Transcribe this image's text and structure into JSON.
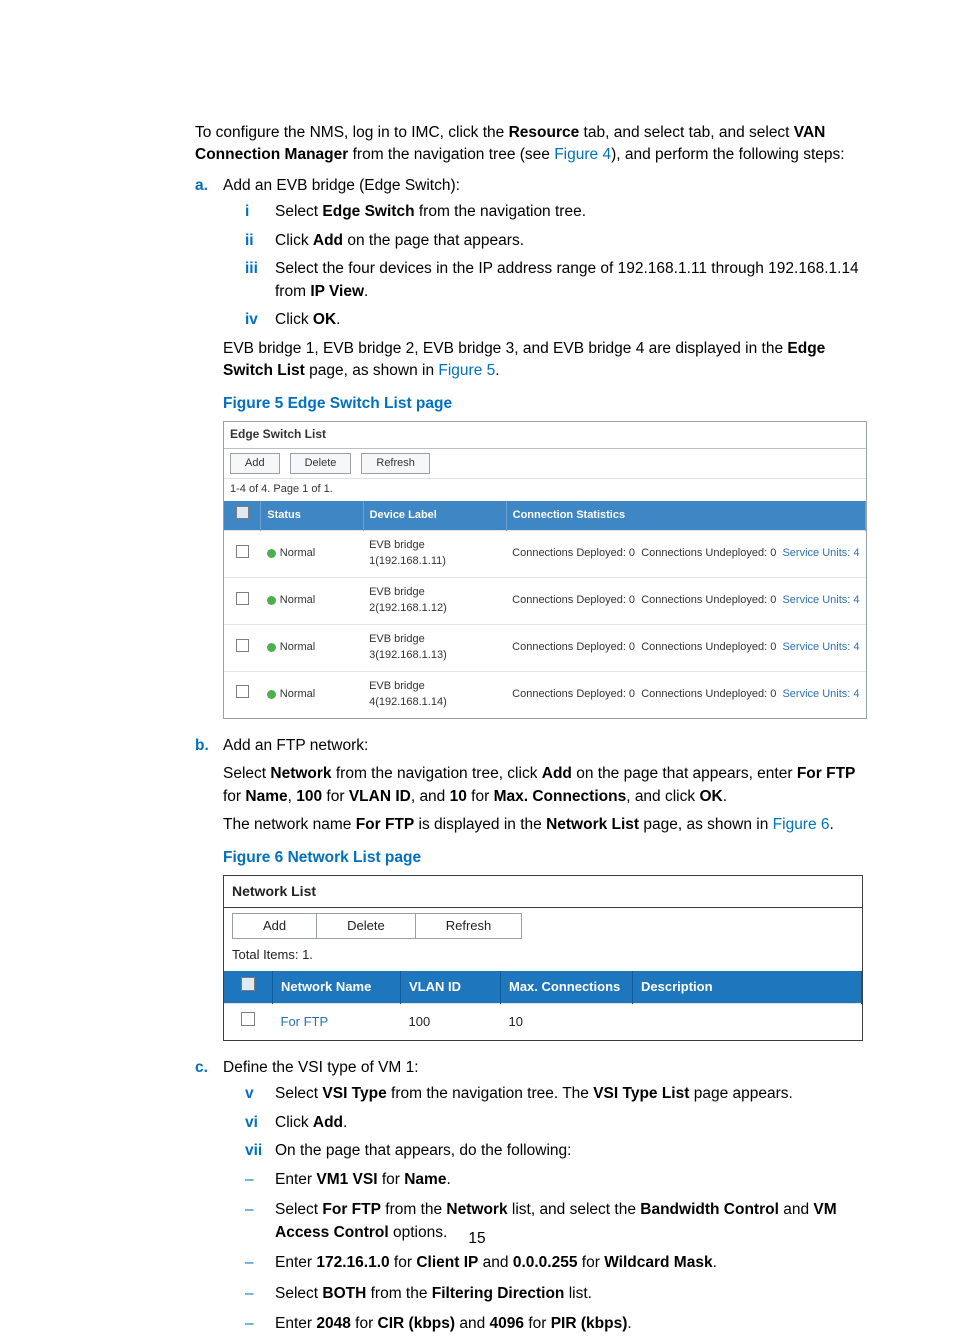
{
  "intro": {
    "p1_pre": "To configure the NMS, log in to IMC, click the ",
    "resource": "Resource",
    "p1_mid": " tab, and select ",
    "vcm": "VAN Connection Manager",
    "p1_post1": " from the navigation tree (see ",
    "fig4": "Figure 4",
    "p1_post2": "), and perform the following steps:"
  },
  "a": {
    "marker": "a.",
    "title": "Add an EVB bridge (Edge Switch):",
    "i": {
      "m": "i",
      "pre": "Select ",
      "b": "Edge Switch",
      "post": " from the navigation tree."
    },
    "ii": {
      "m": "ii",
      "pre": "Click ",
      "b": "Add",
      "post": " on the page that appears."
    },
    "iii": {
      "m": "iii",
      "pre": "Select the four devices in the IP address range of 192.168.1.11 through 192.168.1.14 from ",
      "b": "IP View",
      "post": "."
    },
    "iv": {
      "m": "iv",
      "pre": "Click ",
      "b": "OK",
      "post": "."
    },
    "result_pre": "EVB bridge 1, EVB bridge 2, EVB bridge 3, and EVB bridge 4 are displayed in the ",
    "result_b": "Edge Switch List",
    "result_mid": " page, as shown in ",
    "result_link": "Figure 5",
    "result_post": "."
  },
  "fig5": {
    "caption": "Figure 5 Edge Switch List page",
    "title": "Edge Switch List",
    "buttons": {
      "add": "Add",
      "delete": "Delete",
      "refresh": "Refresh"
    },
    "pager": "1-4 of 4. Page 1 of 1.",
    "headers": {
      "status": "Status",
      "device": "Device Label",
      "conn": "Connection Statistics"
    },
    "rows": [
      {
        "status": "Normal",
        "device": "EVB bridge 1(192.168.1.11)",
        "cd": "Connections Deployed: 0",
        "cu": "Connections Undeployed: 0",
        "su": "Service Units: 4"
      },
      {
        "status": "Normal",
        "device": "EVB bridge 2(192.168.1.12)",
        "cd": "Connections Deployed: 0",
        "cu": "Connections Undeployed: 0",
        "su": "Service Units: 4"
      },
      {
        "status": "Normal",
        "device": "EVB bridge 3(192.168.1.13)",
        "cd": "Connections Deployed: 0",
        "cu": "Connections Undeployed: 0",
        "su": "Service Units: 4"
      },
      {
        "status": "Normal",
        "device": "EVB bridge 4(192.168.1.14)",
        "cd": "Connections Deployed: 0",
        "cu": "Connections Undeployed: 0",
        "su": "Service Units: 4"
      }
    ]
  },
  "b": {
    "marker": "b.",
    "title": "Add an FTP network:",
    "p1": {
      "t1": "Select ",
      "b1": "Network",
      "t2": " from the navigation tree, click ",
      "b2": "Add",
      "t3": " on the page that appears, enter ",
      "b3": "For FTP",
      "t4": " for ",
      "b4": "Name",
      "t5": ", ",
      "b5": "100",
      "t6": " for ",
      "b6": "VLAN ID",
      "t7": ", and ",
      "b7": "10",
      "t8": " for ",
      "b8": "Max. Connections",
      "t9": ", and click ",
      "b9": "OK",
      "t10": "."
    },
    "p2": {
      "t1": "The network name ",
      "b1": "For FTP",
      "t2": " is displayed in the ",
      "b2": "Network List",
      "t3": " page, as shown in ",
      "link": "Figure 6",
      "t4": "."
    }
  },
  "fig6": {
    "caption": "Figure 6 Network List page",
    "title": "Network List",
    "buttons": {
      "add": "Add",
      "delete": "Delete",
      "refresh": "Refresh"
    },
    "total": "Total Items: 1.",
    "headers": {
      "name": "Network Name",
      "vlan": "VLAN ID",
      "max": "Max. Connections",
      "desc": "Description"
    },
    "row": {
      "name": "For FTP",
      "vlan": "100",
      "max": "10",
      "desc": ""
    }
  },
  "c": {
    "marker": "c.",
    "title": "Define the VSI type of VM 1:",
    "v": {
      "m": "v",
      "t1": "Select ",
      "b1": "VSI Type",
      "t2": " from the navigation tree. The ",
      "b2": "VSI Type List",
      "t3": " page appears."
    },
    "vi": {
      "m": "vi",
      "t1": "Click ",
      "b1": "Add",
      "t2": "."
    },
    "vii": {
      "m": "vii",
      "t1": "On the page that appears, do the following:"
    },
    "d1": {
      "t1": "Enter ",
      "b1": "VM1 VSI",
      "t2": " for ",
      "b2": "Name",
      "t3": "."
    },
    "d2": {
      "t1": "Select ",
      "b1": "For FTP",
      "t2": " from the ",
      "b2": "Network",
      "t3": " list, and select the ",
      "b3": "Bandwidth Control",
      "t4": " and ",
      "b4": "VM Access Control",
      "t5": " options."
    },
    "d3": {
      "t1": "Enter ",
      "b1": "172.16.1.0",
      "t2": " for ",
      "b2": "Client IP",
      "t3": " and ",
      "b3": "0.0.0.255",
      "t4": " for ",
      "b4": "Wildcard Mask",
      "t5": "."
    },
    "d4": {
      "t1": "Select ",
      "b1": "BOTH",
      "t2": " from the ",
      "b2": "Filtering Direction",
      "t3": " list."
    },
    "d5": {
      "t1": "Enter ",
      "b1": "2048",
      "t2": " for ",
      "b2": "CIR (kbps)",
      "t3": " and ",
      "b3": "4096",
      "t4": " for ",
      "b4": "PIR (kbps)",
      "t5": "."
    }
  },
  "page_number": "15"
}
